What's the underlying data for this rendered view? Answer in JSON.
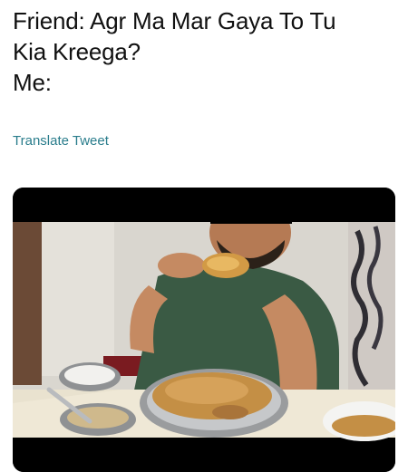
{
  "tweet": {
    "lines": [
      "Friend: Agr Ma Mar Gaya To Tu",
      "Kia Kreega?",
      "Me:"
    ],
    "translate_label": "Translate Tweet"
  },
  "media": {
    "icon": "video-still-person-eating-biryani"
  },
  "colors": {
    "link": "#2a7d8c",
    "text": "#111111",
    "media_background": "#000000"
  }
}
